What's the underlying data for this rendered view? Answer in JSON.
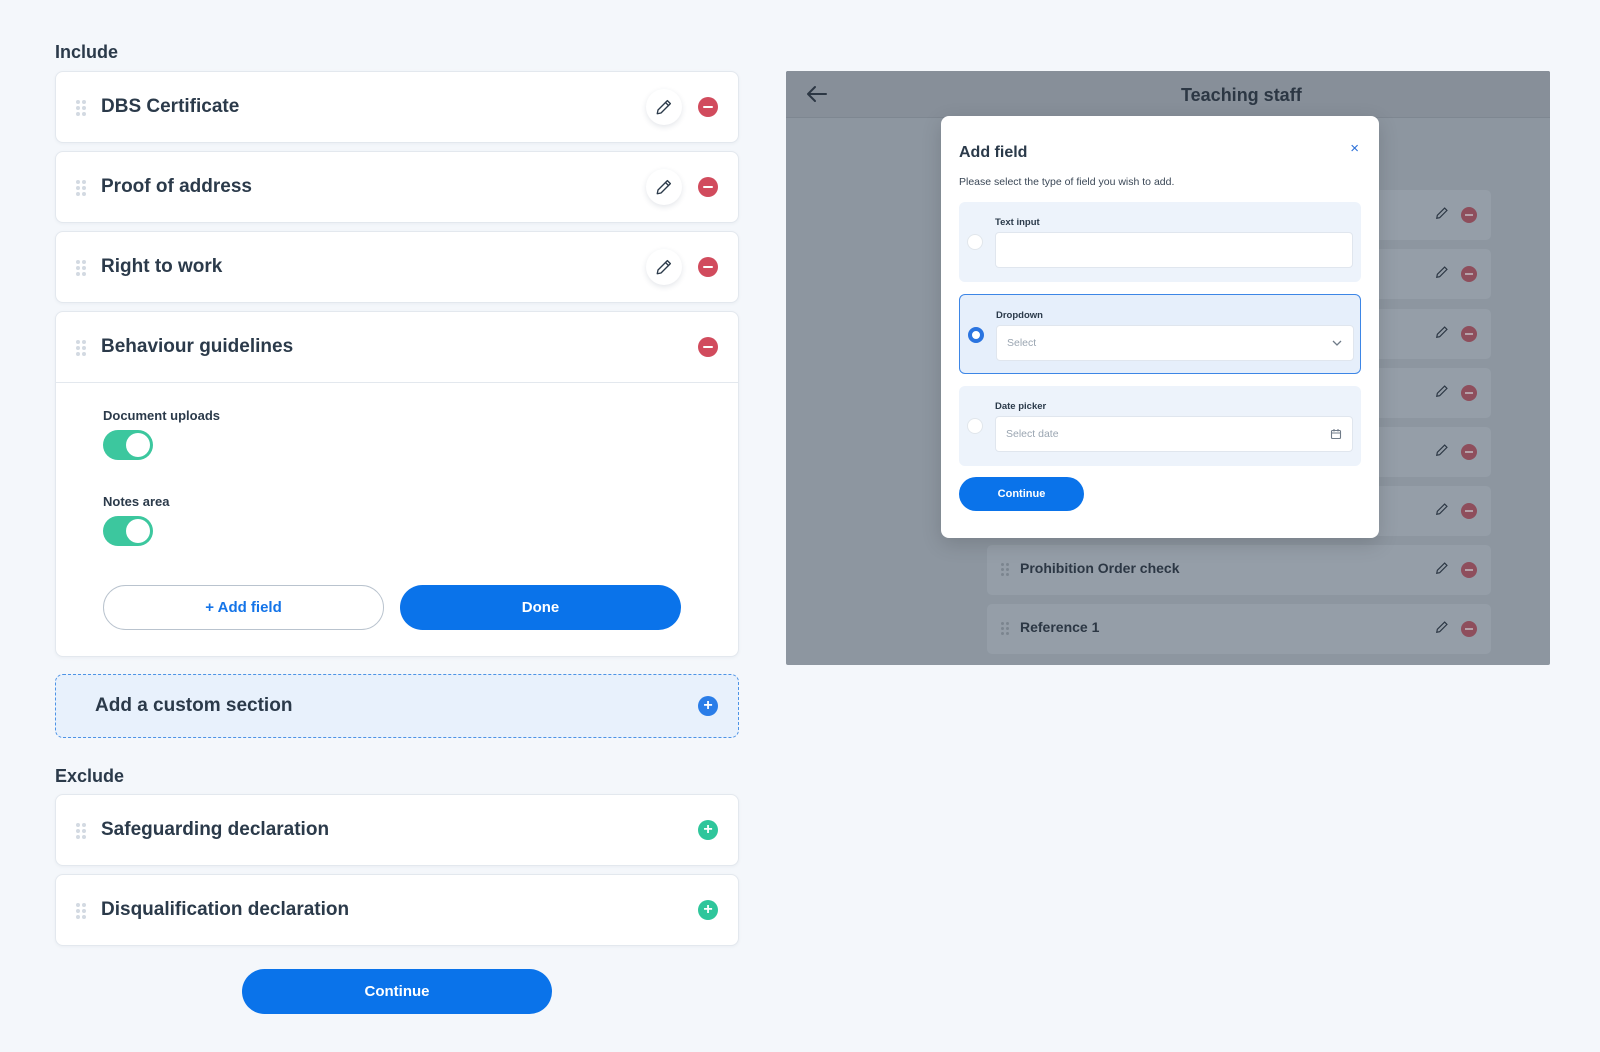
{
  "include": {
    "heading": "Include",
    "items": [
      {
        "title": "DBS Certificate"
      },
      {
        "title": "Proof of address"
      },
      {
        "title": "Right to work"
      }
    ],
    "expanded": {
      "title": "Behaviour guidelines",
      "toggles": [
        {
          "label": "Document uploads",
          "on": true
        },
        {
          "label": "Notes area",
          "on": true
        }
      ],
      "add_field_label": "+ Add field",
      "done_label": "Done"
    },
    "custom_section_label": "Add a custom section"
  },
  "exclude": {
    "heading": "Exclude",
    "items": [
      {
        "title": "Safeguarding declaration"
      },
      {
        "title": "Disqualification declaration"
      }
    ]
  },
  "continue_label": "Continue",
  "preview": {
    "title": "Teaching staff",
    "visible_rows": [
      {
        "title": "Prohibition Order check"
      },
      {
        "title": "Reference 1"
      }
    ],
    "modal": {
      "title": "Add field",
      "close": "×",
      "description": "Please select the type of field you wish to add.",
      "options": [
        {
          "label": "Text input",
          "value": "",
          "placeholder": "",
          "selected": false
        },
        {
          "label": "Dropdown",
          "value": "",
          "placeholder": "Select",
          "selected": true
        },
        {
          "label": "Date picker",
          "value": "",
          "placeholder": "Select date",
          "selected": false
        }
      ],
      "continue_label": "Continue"
    }
  },
  "colors": {
    "primary": "#0a73ea",
    "remove": "#d14b5d",
    "add": "#2fc69b",
    "toggle_on": "#3cc79e"
  }
}
